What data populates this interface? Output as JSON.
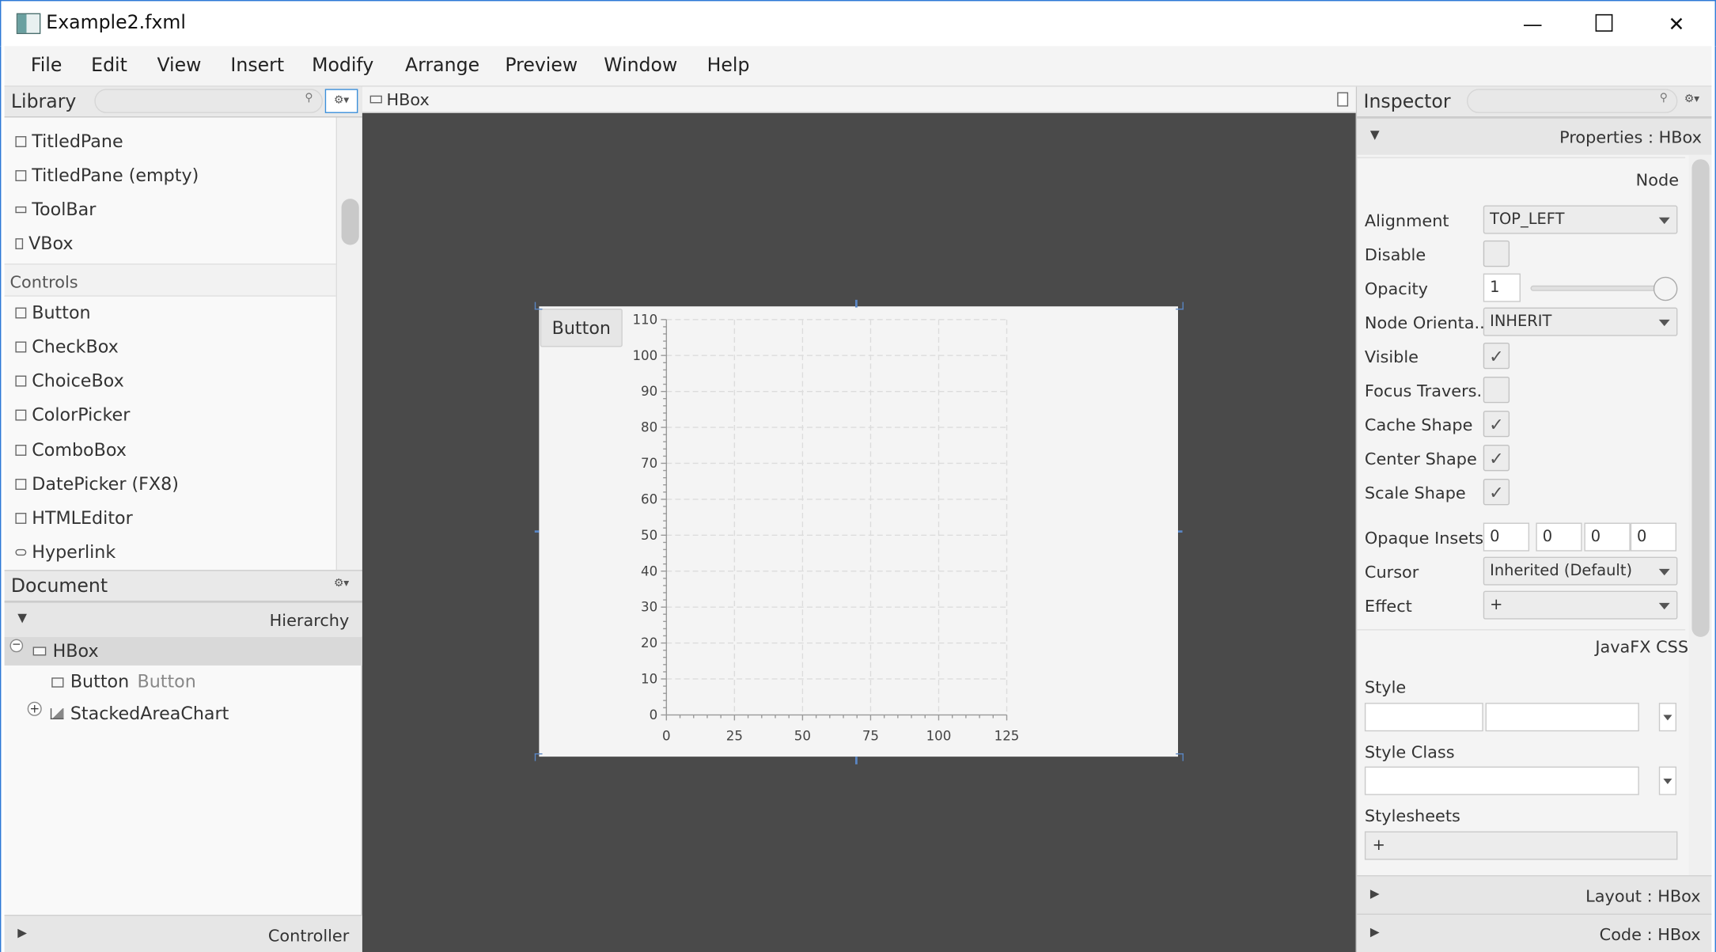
{
  "window": {
    "title": "Example2.fxml",
    "minimize": "—",
    "maximize": "☐",
    "close": "✕"
  },
  "menu": [
    "File",
    "Edit",
    "View",
    "Insert",
    "Modify",
    "Arrange",
    "Preview",
    "Window",
    "Help"
  ],
  "library": {
    "title": "Library",
    "items_top": [
      "TitledPane",
      "TitledPane  (empty)",
      "ToolBar",
      "VBox"
    ],
    "section": "Controls",
    "items_controls": [
      "Button",
      "CheckBox",
      "ChoiceBox",
      "ColorPicker",
      "ComboBox",
      "DatePicker  (FX8)",
      "HTMLEditor",
      "Hyperlink"
    ]
  },
  "document": {
    "title": "Document",
    "hierarchy_label": "Hierarchy",
    "tree": [
      {
        "label": "HBox",
        "sub": ""
      },
      {
        "label": "Button",
        "sub": "Button"
      },
      {
        "label": "StackedAreaChart",
        "sub": ""
      }
    ],
    "controller_label": "Controller"
  },
  "canvas": {
    "breadcrumb": "HBox",
    "button_label": "Button"
  },
  "chart_data": {
    "type": "area",
    "title": "",
    "xlabel": "",
    "ylabel": "",
    "x_ticks": [
      0,
      25,
      50,
      75,
      100,
      125
    ],
    "y_ticks": [
      0,
      10,
      20,
      30,
      40,
      50,
      60,
      70,
      80,
      90,
      100,
      110
    ],
    "xlim": [
      0,
      125
    ],
    "ylim": [
      0,
      110
    ],
    "grid": true,
    "series": []
  },
  "inspector": {
    "title": "Inspector",
    "properties_label": "Properties : HBox",
    "node_section": "Node",
    "rows": {
      "alignment": {
        "label": "Alignment",
        "value": "TOP_LEFT"
      },
      "disable": {
        "label": "Disable",
        "checked": false
      },
      "opacity": {
        "label": "Opacity",
        "value": "1",
        "slider_fraction": 1.0
      },
      "node_orientation": {
        "label": "Node Orienta...",
        "value": "INHERIT"
      },
      "visible": {
        "label": "Visible",
        "checked": true
      },
      "focus_traversable": {
        "label": "Focus Travers...",
        "checked": false
      },
      "cache_shape": {
        "label": "Cache Shape",
        "checked": true
      },
      "center_shape": {
        "label": "Center Shape",
        "checked": true
      },
      "scale_shape": {
        "label": "Scale Shape",
        "checked": true
      },
      "opaque_insets": {
        "label": "Opaque Insets",
        "values": [
          "0",
          "0",
          "0",
          "0"
        ]
      },
      "cursor": {
        "label": "Cursor",
        "value": "Inherited (Default)"
      },
      "effect": {
        "label": "Effect",
        "value": "+"
      }
    },
    "css_section": "JavaFX CSS",
    "style_label": "Style",
    "style_class_label": "Style Class",
    "stylesheets_label": "Stylesheets",
    "stylesheets_add": "+",
    "layout_label": "Layout : HBox",
    "code_label": "Code : HBox",
    "checkmark": "✓"
  },
  "colors": {
    "canvas_bg": "#4a4a4a",
    "selection": "#5a86c4",
    "window_border": "#2b78d6"
  }
}
